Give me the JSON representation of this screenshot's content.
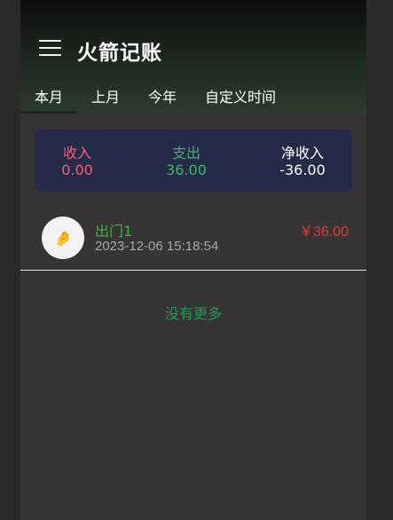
{
  "header": {
    "title": "火箭记账",
    "menu_icon": "hamburger-menu-icon"
  },
  "tabs": [
    {
      "label": "本月",
      "active": true
    },
    {
      "label": "上月",
      "active": false
    },
    {
      "label": "今年",
      "active": false
    },
    {
      "label": "自定义时间",
      "active": false
    }
  ],
  "summary": {
    "income": {
      "label": "收入",
      "value": "0.00"
    },
    "expense": {
      "label": "支出",
      "value": "36.00"
    },
    "net": {
      "label": "净收入",
      "value": "-36.00"
    }
  },
  "entries": [
    {
      "name": "出门1",
      "time": "2023-12-06 15:18:54",
      "amount": "￥36.00",
      "icon": "hand-emoji-icon",
      "glyph": "🤌"
    }
  ],
  "footer": {
    "no_more": "没有更多"
  },
  "colors": {
    "income": "#f0607a",
    "expense": "#3fb46a",
    "amount": "#e53935",
    "summary_bg": "#262a49",
    "no_more": "#1e9b55"
  }
}
